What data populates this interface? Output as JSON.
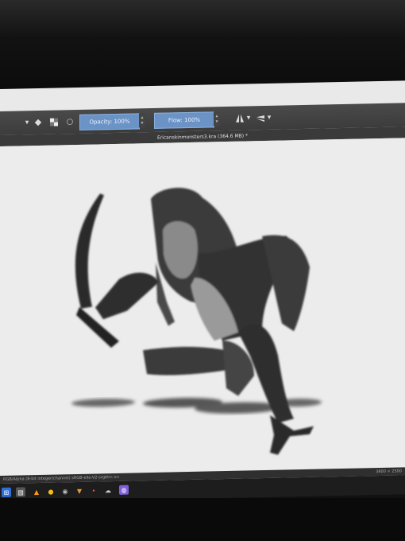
{
  "toolbar": {
    "opacity_label": "Opacity: 100%",
    "flow_label": "Flow: 100%",
    "icons": [
      "chevron-down-icon",
      "eraser-icon",
      "alpha-lock-icon",
      "reset-icon",
      "mirror-horizontal-icon",
      "mirror-vertical-icon"
    ]
  },
  "document": {
    "title": "Ericanskinmonsters3.kra (364.6 MB) *"
  },
  "status": {
    "color_space": "RGB/Alpha (8-bit integer/channel)  sRGB-elle-V2-srgbtrc.icc",
    "canvas_size": "3800 × 2500"
  },
  "taskbar": {
    "apps": [
      "windows-start-icon",
      "file-icon",
      "vlc-icon",
      "chrome-icon",
      "steam-icon",
      "krita-icon",
      "dot-icon",
      "cloud-icon",
      "app-icon"
    ]
  },
  "colors": {
    "accent": "#6b93c6",
    "toolbar": "#3c3c3c",
    "canvas": "#ececec"
  }
}
